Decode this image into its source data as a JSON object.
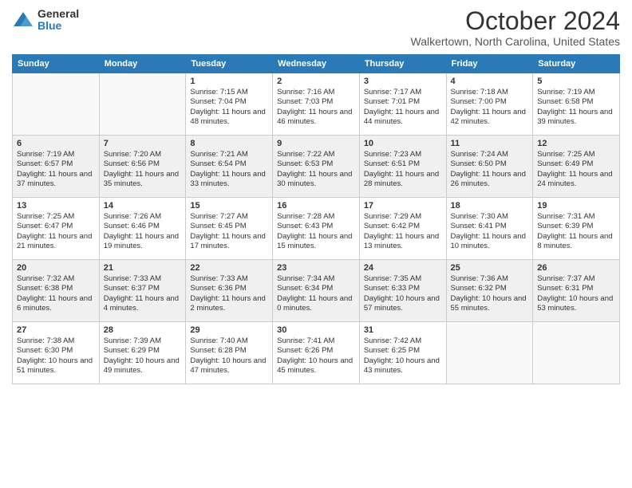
{
  "logo": {
    "general": "General",
    "blue": "Blue"
  },
  "title": "October 2024",
  "location": "Walkertown, North Carolina, United States",
  "weekdays": [
    "Sunday",
    "Monday",
    "Tuesday",
    "Wednesday",
    "Thursday",
    "Friday",
    "Saturday"
  ],
  "weeks": [
    [
      {
        "day": "",
        "info": ""
      },
      {
        "day": "",
        "info": ""
      },
      {
        "day": "1",
        "sunrise": "7:15 AM",
        "sunset": "7:04 PM",
        "daylight": "11 hours and 48 minutes."
      },
      {
        "day": "2",
        "sunrise": "7:16 AM",
        "sunset": "7:03 PM",
        "daylight": "11 hours and 46 minutes."
      },
      {
        "day": "3",
        "sunrise": "7:17 AM",
        "sunset": "7:01 PM",
        "daylight": "11 hours and 44 minutes."
      },
      {
        "day": "4",
        "sunrise": "7:18 AM",
        "sunset": "7:00 PM",
        "daylight": "11 hours and 42 minutes."
      },
      {
        "day": "5",
        "sunrise": "7:19 AM",
        "sunset": "6:58 PM",
        "daylight": "11 hours and 39 minutes."
      }
    ],
    [
      {
        "day": "6",
        "sunrise": "7:19 AM",
        "sunset": "6:57 PM",
        "daylight": "11 hours and 37 minutes."
      },
      {
        "day": "7",
        "sunrise": "7:20 AM",
        "sunset": "6:56 PM",
        "daylight": "11 hours and 35 minutes."
      },
      {
        "day": "8",
        "sunrise": "7:21 AM",
        "sunset": "6:54 PM",
        "daylight": "11 hours and 33 minutes."
      },
      {
        "day": "9",
        "sunrise": "7:22 AM",
        "sunset": "6:53 PM",
        "daylight": "11 hours and 30 minutes."
      },
      {
        "day": "10",
        "sunrise": "7:23 AM",
        "sunset": "6:51 PM",
        "daylight": "11 hours and 28 minutes."
      },
      {
        "day": "11",
        "sunrise": "7:24 AM",
        "sunset": "6:50 PM",
        "daylight": "11 hours and 26 minutes."
      },
      {
        "day": "12",
        "sunrise": "7:25 AM",
        "sunset": "6:49 PM",
        "daylight": "11 hours and 24 minutes."
      }
    ],
    [
      {
        "day": "13",
        "sunrise": "7:25 AM",
        "sunset": "6:47 PM",
        "daylight": "11 hours and 21 minutes."
      },
      {
        "day": "14",
        "sunrise": "7:26 AM",
        "sunset": "6:46 PM",
        "daylight": "11 hours and 19 minutes."
      },
      {
        "day": "15",
        "sunrise": "7:27 AM",
        "sunset": "6:45 PM",
        "daylight": "11 hours and 17 minutes."
      },
      {
        "day": "16",
        "sunrise": "7:28 AM",
        "sunset": "6:43 PM",
        "daylight": "11 hours and 15 minutes."
      },
      {
        "day": "17",
        "sunrise": "7:29 AM",
        "sunset": "6:42 PM",
        "daylight": "11 hours and 13 minutes."
      },
      {
        "day": "18",
        "sunrise": "7:30 AM",
        "sunset": "6:41 PM",
        "daylight": "11 hours and 10 minutes."
      },
      {
        "day": "19",
        "sunrise": "7:31 AM",
        "sunset": "6:39 PM",
        "daylight": "11 hours and 8 minutes."
      }
    ],
    [
      {
        "day": "20",
        "sunrise": "7:32 AM",
        "sunset": "6:38 PM",
        "daylight": "11 hours and 6 minutes."
      },
      {
        "day": "21",
        "sunrise": "7:33 AM",
        "sunset": "6:37 PM",
        "daylight": "11 hours and 4 minutes."
      },
      {
        "day": "22",
        "sunrise": "7:33 AM",
        "sunset": "6:36 PM",
        "daylight": "11 hours and 2 minutes."
      },
      {
        "day": "23",
        "sunrise": "7:34 AM",
        "sunset": "6:34 PM",
        "daylight": "11 hours and 0 minutes."
      },
      {
        "day": "24",
        "sunrise": "7:35 AM",
        "sunset": "6:33 PM",
        "daylight": "10 hours and 57 minutes."
      },
      {
        "day": "25",
        "sunrise": "7:36 AM",
        "sunset": "6:32 PM",
        "daylight": "10 hours and 55 minutes."
      },
      {
        "day": "26",
        "sunrise": "7:37 AM",
        "sunset": "6:31 PM",
        "daylight": "10 hours and 53 minutes."
      }
    ],
    [
      {
        "day": "27",
        "sunrise": "7:38 AM",
        "sunset": "6:30 PM",
        "daylight": "10 hours and 51 minutes."
      },
      {
        "day": "28",
        "sunrise": "7:39 AM",
        "sunset": "6:29 PM",
        "daylight": "10 hours and 49 minutes."
      },
      {
        "day": "29",
        "sunrise": "7:40 AM",
        "sunset": "6:28 PM",
        "daylight": "10 hours and 47 minutes."
      },
      {
        "day": "30",
        "sunrise": "7:41 AM",
        "sunset": "6:26 PM",
        "daylight": "10 hours and 45 minutes."
      },
      {
        "day": "31",
        "sunrise": "7:42 AM",
        "sunset": "6:25 PM",
        "daylight": "10 hours and 43 minutes."
      },
      {
        "day": "",
        "info": ""
      },
      {
        "day": "",
        "info": ""
      }
    ]
  ]
}
